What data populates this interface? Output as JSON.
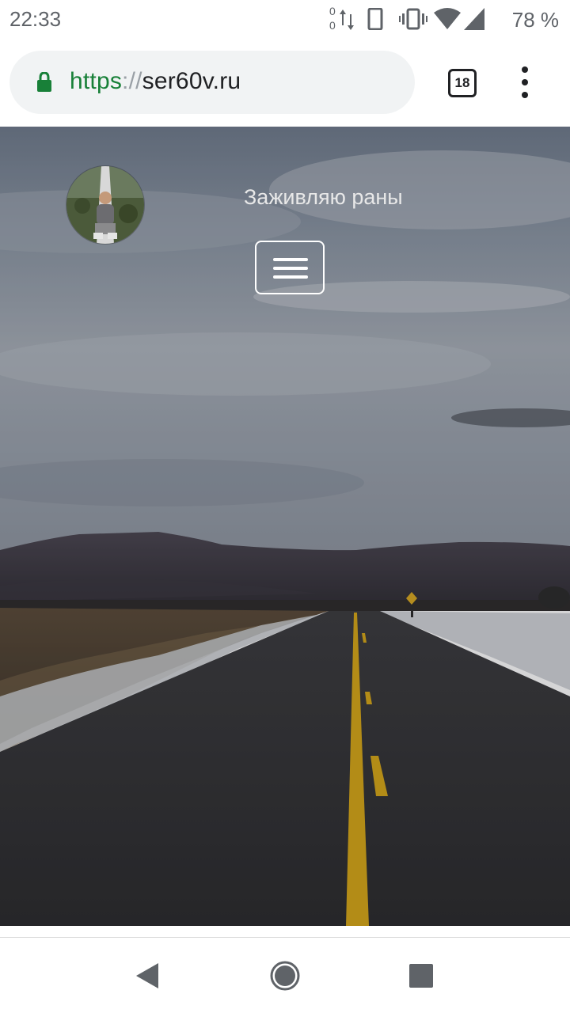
{
  "status_bar": {
    "time": "22:33",
    "battery": "78 %",
    "icons": [
      "data-activity-icon",
      "vibrate-icon",
      "wifi-icon",
      "signal-icon"
    ],
    "data_counter_top": "0",
    "data_counter_bottom": "0"
  },
  "browser": {
    "url_scheme": "https",
    "url_separator": "://",
    "url_host": "ser60v.ru",
    "tab_count": "18",
    "secure_color": "#188038"
  },
  "page": {
    "site_title": "Заживляю раны",
    "menu_icon": "hamburger-icon"
  },
  "nav_bar": {
    "icons": [
      "back-icon",
      "home-icon",
      "recents-icon"
    ]
  }
}
